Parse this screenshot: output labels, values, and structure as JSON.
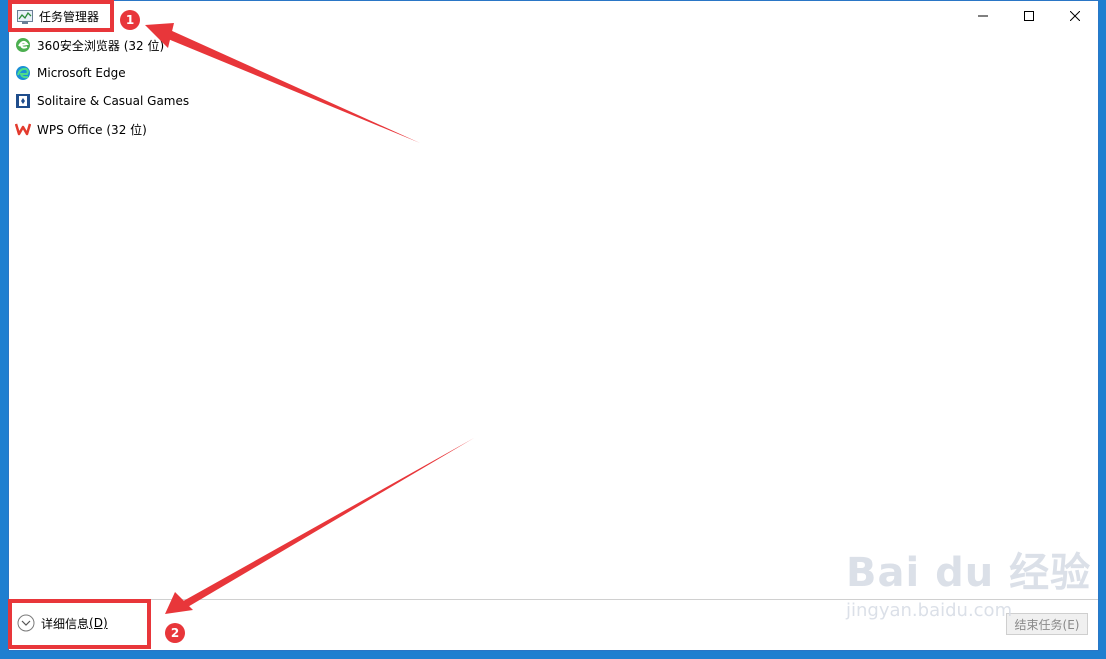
{
  "window": {
    "title": "任务管理器",
    "controls": {
      "minimize": "minimize-icon",
      "maximize": "maximize-icon",
      "close": "close-icon"
    }
  },
  "apps": [
    {
      "label": "360安全浏览器 (32 位)",
      "icon": "360-browser-icon"
    },
    {
      "label": "Microsoft Edge",
      "icon": "edge-icon"
    },
    {
      "label": "Solitaire & Casual Games",
      "icon": "solitaire-icon"
    },
    {
      "label": "WPS Office (32 位)",
      "icon": "wps-icon"
    }
  ],
  "footer": {
    "details_label": "详细信息",
    "details_shortcut": "(D)",
    "end_task_label": "结束任务(E)"
  },
  "annotations": {
    "badge_1": "1",
    "badge_2": "2",
    "color": "#e8363a"
  },
  "watermark": {
    "main": "Bai du 经验",
    "sub": "jingyan.baidu.com"
  }
}
